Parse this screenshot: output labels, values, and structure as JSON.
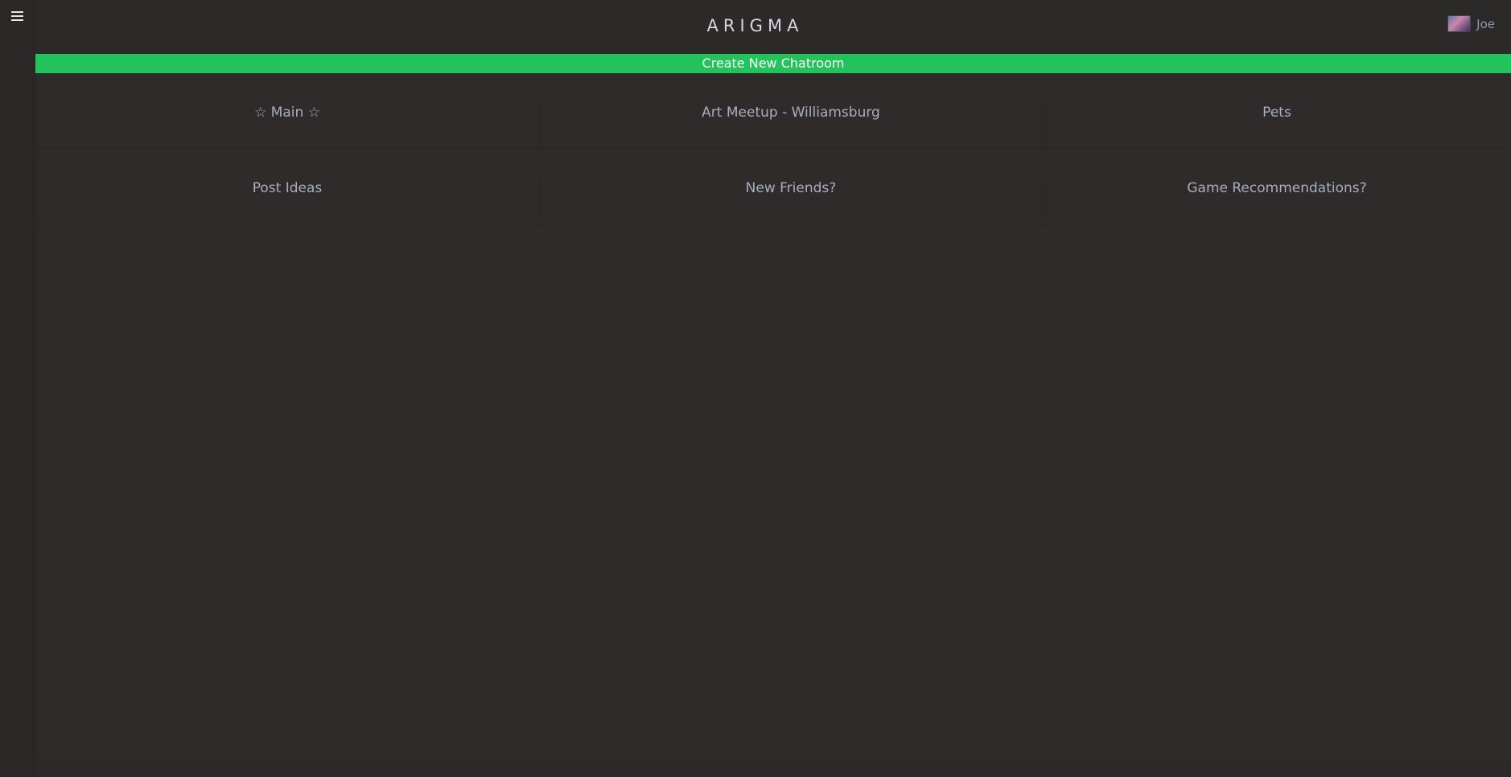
{
  "app": {
    "brand": "ARIGMA"
  },
  "user": {
    "name": "Joe"
  },
  "actions": {
    "create_label": "Create New Chatroom"
  },
  "chatrooms": [
    {
      "label": "☆ Main ☆"
    },
    {
      "label": "Art Meetup - Williamsburg"
    },
    {
      "label": "Pets"
    },
    {
      "label": "Post Ideas"
    },
    {
      "label": "New Friends?"
    },
    {
      "label": "Game Recommendations?"
    }
  ],
  "colors": {
    "accent": "#22c35a",
    "background": "#2f2b2a",
    "text_muted": "#a7adbf"
  },
  "icons": {
    "menu": "hamburger-menu-icon"
  }
}
